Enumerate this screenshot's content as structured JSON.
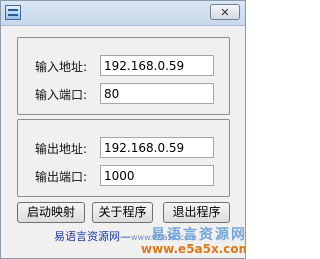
{
  "titlebar": {
    "icon": "app-icon",
    "close_label": "✕"
  },
  "input_group": {
    "address_label": "输入地址:",
    "address_value": "192.168.0.59",
    "port_label": "输入端口:",
    "port_value": "80"
  },
  "output_group": {
    "address_label": "输出地址:",
    "address_value": "192.168.0.59",
    "port_label": "输出端口:",
    "port_value": "1000"
  },
  "buttons": {
    "start": "启动映射",
    "about": "关于程序",
    "quit": "退出程序"
  },
  "footer": {
    "link_text": "易语言资源网—",
    "link_sub": "www.e5a5x.com"
  },
  "watermark": {
    "cn": "易语言资源网",
    "url": "www.e5a5x.com"
  }
}
